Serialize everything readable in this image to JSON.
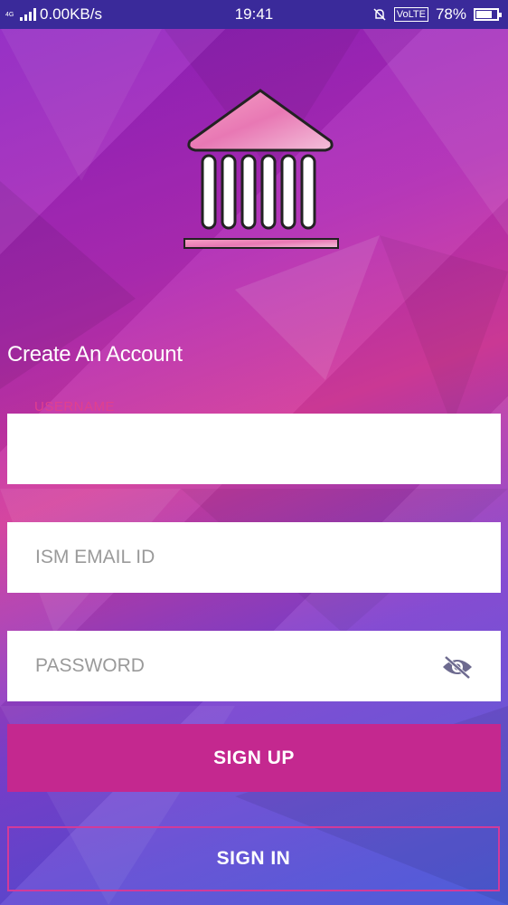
{
  "status_bar": {
    "network_tag": "4G",
    "data_speed": "0.00KB/s",
    "time": "19:41",
    "volte_badge": "VoLTE",
    "battery_percent": "78%",
    "battery_level": 0.78
  },
  "heading": "Create An Account",
  "form": {
    "username": {
      "label": "USERNAME",
      "value": ""
    },
    "email": {
      "placeholder": "ISM EMAIL ID",
      "value": ""
    },
    "password": {
      "placeholder": "PASSWORD",
      "value": "",
      "toggle_icon": "eye-off-icon"
    }
  },
  "buttons": {
    "sign_up": "SIGN UP",
    "sign_in": "SIGN IN"
  },
  "colors": {
    "accent": "#c4288f",
    "status_bar": "#3a2a9a",
    "label": "#e0408e"
  }
}
